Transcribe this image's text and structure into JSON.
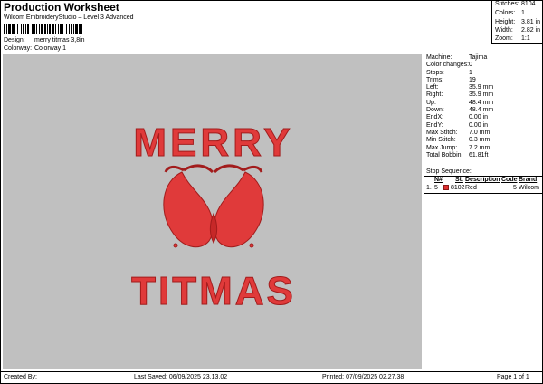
{
  "header": {
    "title": "Production Worksheet",
    "subtitle": "Wilcom EmbroideryStudio – Level 3 Advanced",
    "barcode_icon": "barcode",
    "design_label": "Design:",
    "design_value": "merry titmas 3,8in",
    "colorway_label": "Colorway:",
    "colorway_value": "Colorway 1"
  },
  "summary": [
    {
      "label": "Stitches:",
      "value": "8104"
    },
    {
      "label": "Colors:",
      "value": "1"
    },
    {
      "label": "Height:",
      "value": "3.81 in"
    },
    {
      "label": "Width:",
      "value": "2.82 in"
    },
    {
      "label": "Zoom:",
      "value": "1:1"
    }
  ],
  "design_preview": {
    "top_text": "MERRY",
    "bottom_text": "TITMAS",
    "thread_color": "#e03a3a",
    "canvas_color": "#c0c0c0"
  },
  "machine_info": [
    {
      "label": "Machine:",
      "value": "Tajima"
    },
    {
      "label": "Color changes:",
      "value": "0"
    },
    {
      "label": "Stops:",
      "value": "1"
    },
    {
      "label": "Trims:",
      "value": "19"
    },
    {
      "label": "Left:",
      "value": "35.9 mm"
    },
    {
      "label": "Right:",
      "value": "35.9 mm"
    },
    {
      "label": "Up:",
      "value": "48.4 mm"
    },
    {
      "label": "Down:",
      "value": "48.4 mm"
    },
    {
      "label": "EndX:",
      "value": "0.00 in"
    },
    {
      "label": "EndY:",
      "value": "0.00 in"
    },
    {
      "label": "Max Stitch:",
      "value": "7.0 mm"
    },
    {
      "label": "Min Stitch:",
      "value": "0.3 mm"
    },
    {
      "label": "Max Jump:",
      "value": "7.2 mm"
    },
    {
      "label": "Total Bobbin:",
      "value": "61.81ft"
    }
  ],
  "stop_sequence": {
    "title": "Stop Sequence:",
    "columns": [
      "N#",
      "St.",
      "Description",
      "Code",
      "Brand"
    ],
    "rows": [
      {
        "index": "1.",
        "n": "5",
        "st": "8102",
        "description": "Red",
        "code": "5",
        "brand": "Wilcom",
        "color": "#e03030"
      }
    ]
  },
  "footer": {
    "created_by": "Created By:",
    "last_saved": "Last Saved: 06/09/2025 23.13.02",
    "printed": "Printed: 07/09/2025 02.27.38",
    "page": "Page 1 of 1"
  }
}
